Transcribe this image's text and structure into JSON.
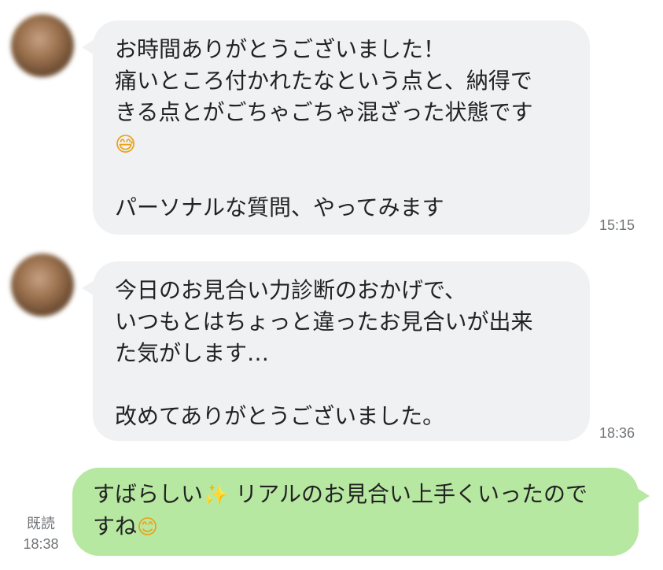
{
  "messages": [
    {
      "direction": "incoming",
      "text_line1": "お時間ありがとうございました！",
      "text_line2": "痛いところ付かれたなという点と、納得で",
      "text_line3": "きる点とがごちゃごちゃ混ざった状態です",
      "emoji": "😅",
      "emoji_icon": "grinning-sweat-icon",
      "text_line5": "パーソナルな質問、やってみます",
      "time": "15:15"
    },
    {
      "direction": "incoming",
      "text_line1": "今日のお見合い力診断のおかげで、",
      "text_line2": "いつもとはちょっと違ったお見合いが出来",
      "text_line3": "た気がします…",
      "text_line5": "改めてありがとうございました。",
      "time": "18:36"
    },
    {
      "direction": "outgoing",
      "text_part1": "すばらしい",
      "emoji1": "✨",
      "emoji1_icon": "sparkles-icon",
      "text_part2": " リアルのお見合い上手くいったので",
      "text_line2": "すね",
      "emoji2": "😊",
      "emoji2_icon": "smiling-face-icon",
      "read_label": "既読",
      "time": "18:38"
    }
  ],
  "colors": {
    "incoming_bubble": "#f0f1f3",
    "outgoing_bubble": "#b7e8a2",
    "meta_text": "#6f7478"
  }
}
